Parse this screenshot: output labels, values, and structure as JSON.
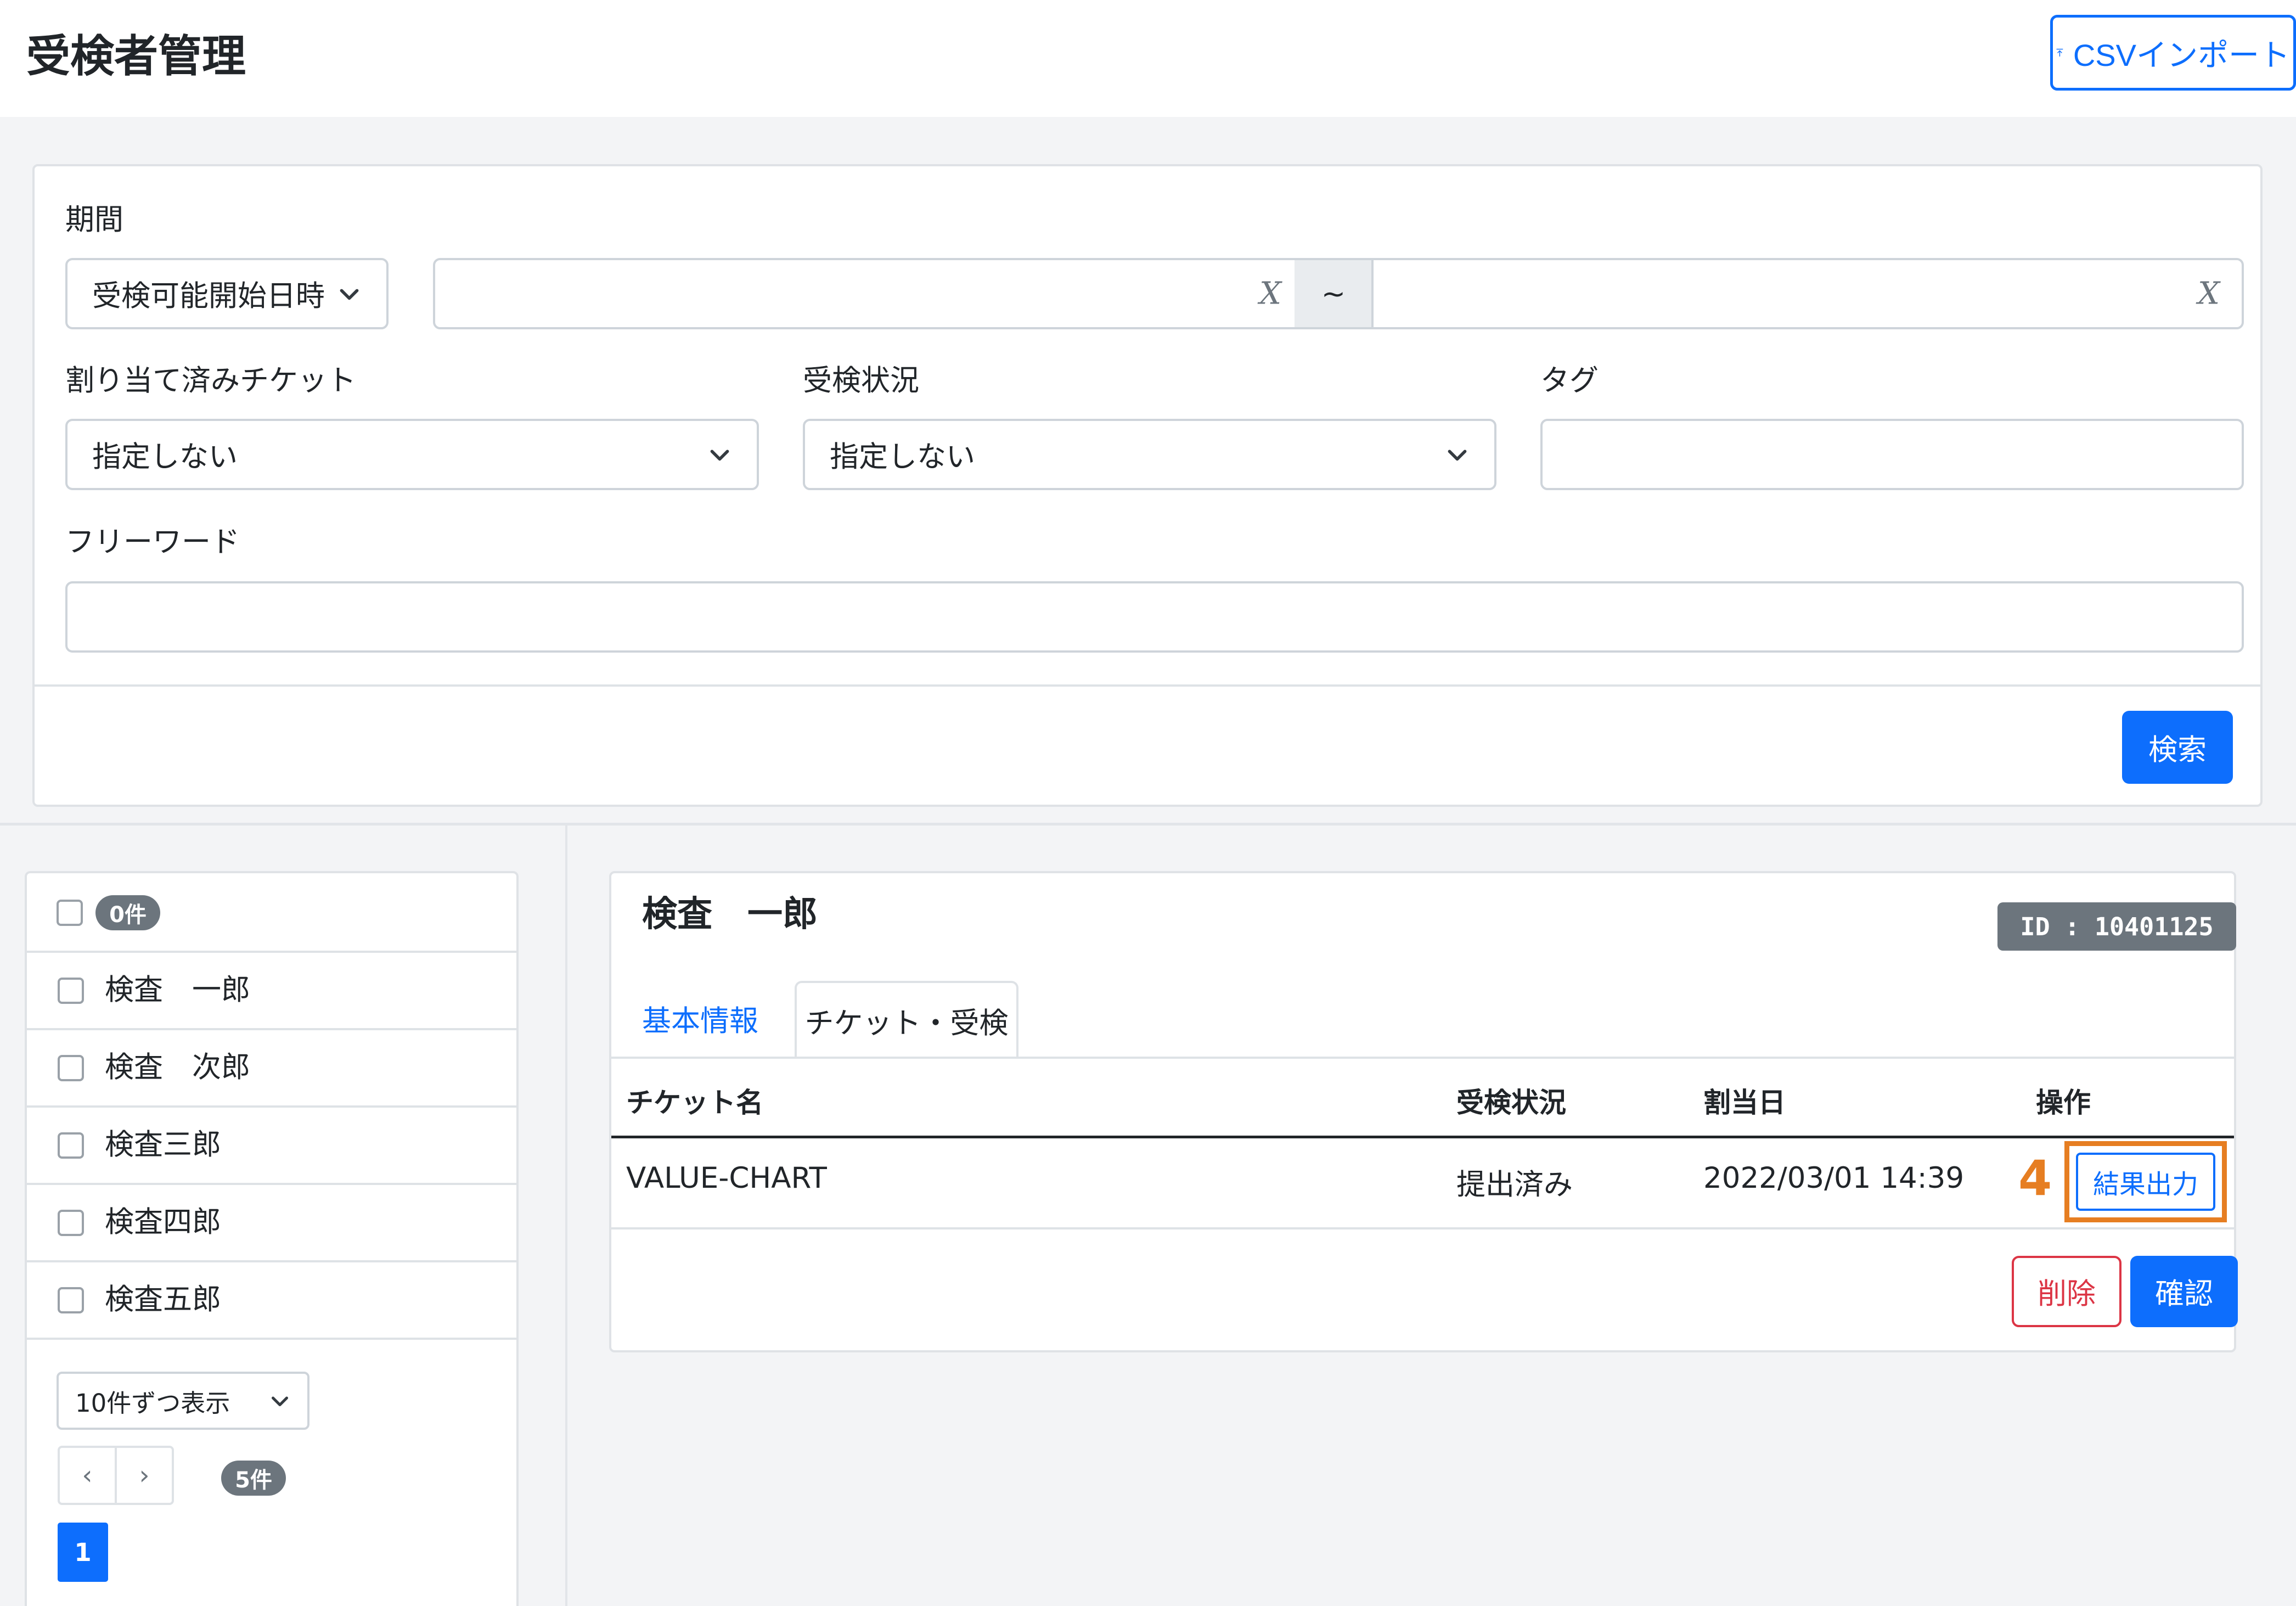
{
  "header": {
    "title": "受検者管理",
    "import_button_label": "CSVインポート"
  },
  "search": {
    "period_label": "期間",
    "period_type_value": "受検可能開始日時",
    "range_separator": "~",
    "clear_symbol": "X",
    "assigned_ticket_label": "割り当て済みチケット",
    "assigned_ticket_value": "指定しない",
    "exam_status_label": "受検状況",
    "exam_status_value": "指定しない",
    "tag_label": "タグ",
    "tag_value": "",
    "freeword_label": "フリーワード",
    "freeword_value": "",
    "search_button_label": "検索"
  },
  "list": {
    "selected_count": "0件",
    "items": [
      {
        "name": "検査　一郎"
      },
      {
        "name": "検査　次郎"
      },
      {
        "name": "検査三郎"
      },
      {
        "name": "検査四郎"
      },
      {
        "name": "検査五郎"
      }
    ],
    "page_size_value": "10件ずつ表示",
    "prev_symbol": "‹",
    "next_symbol": "›",
    "total_count": "5件",
    "current_page": "1"
  },
  "detail": {
    "name": "検査　一郎",
    "id_badge": "ID : 10401125",
    "tabs": [
      {
        "label": "基本情報",
        "active": false
      },
      {
        "label": "チケット・受検",
        "active": true
      }
    ],
    "table": {
      "headers": [
        "チケット名",
        "受検状況",
        "割当日",
        "操作"
      ],
      "rows": [
        {
          "ticket": "VALUE-CHART",
          "status": "提出済み",
          "date": "2022/03/01 14:39",
          "action": "結果出力"
        }
      ]
    },
    "annotation_step": "4",
    "delete_label": "削除",
    "confirm_label": "確認"
  },
  "colors": {
    "primary": "#0d6efd",
    "danger": "#dc3545",
    "badge": "#6c757d",
    "annotation": "#e67e22"
  }
}
